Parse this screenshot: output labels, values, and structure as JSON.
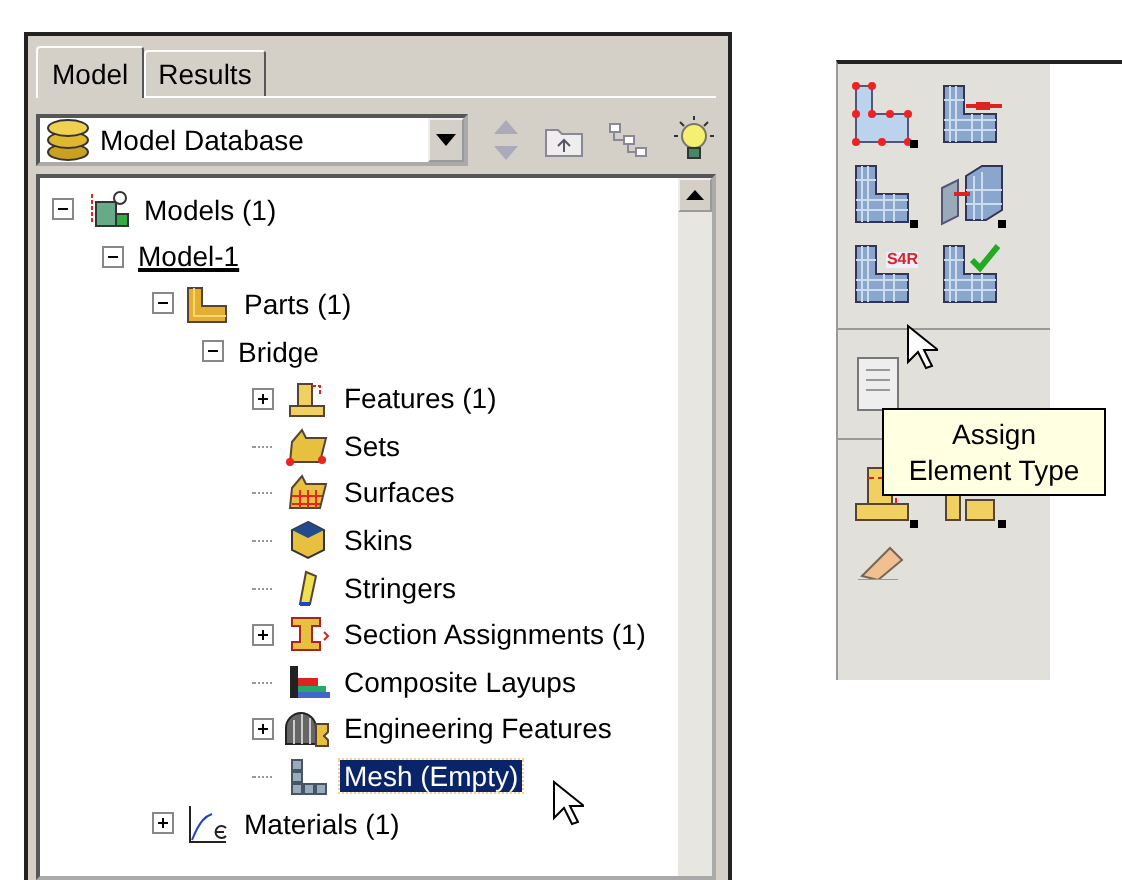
{
  "tabs": [
    {
      "label": "Model",
      "selected": true
    },
    {
      "label": "Results",
      "selected": false
    }
  ],
  "selector": {
    "value": "Model Database"
  },
  "tree": [
    {
      "label": "Models (1)",
      "kind": "models",
      "expanded": true,
      "selected": false,
      "current": false,
      "children": [
        {
          "label": "Model-1",
          "expanded": true,
          "selected": false,
          "current": true,
          "children": [
            {
              "label": "Parts (1)",
              "kind": "parts",
              "expanded": true,
              "selected": false,
              "current": false,
              "children": [
                {
                  "label": "Bridge",
                  "expanded": true,
                  "selected": false,
                  "current": false,
                  "children": [
                    {
                      "label": "Features (1)",
                      "kind": "features",
                      "expanded": false,
                      "selected": false,
                      "current": false
                    },
                    {
                      "label": "Sets",
                      "kind": "sets",
                      "selected": false,
                      "current": false
                    },
                    {
                      "label": "Surfaces",
                      "kind": "surfaces",
                      "selected": false,
                      "current": false
                    },
                    {
                      "label": "Skins",
                      "kind": "skins",
                      "selected": false,
                      "current": false
                    },
                    {
                      "label": "Stringers",
                      "kind": "stringers",
                      "selected": false,
                      "current": false
                    },
                    {
                      "label": "Section Assignments (1)",
                      "kind": "section",
                      "expanded": false,
                      "selected": false,
                      "current": false
                    },
                    {
                      "label": "Composite Layups",
                      "kind": "layups",
                      "selected": false,
                      "current": false
                    },
                    {
                      "label": "Engineering Features",
                      "kind": "engineering",
                      "expanded": false,
                      "selected": false,
                      "current": false
                    },
                    {
                      "label": "Mesh (Empty)",
                      "kind": "mesh",
                      "selected": true,
                      "current": false
                    }
                  ]
                }
              ]
            },
            {
              "label": "Materials (1)",
              "kind": "materials",
              "expanded": false,
              "selected": false,
              "current": false
            }
          ]
        }
      ]
    }
  ],
  "toolbox": {
    "element_type_label": "S4R",
    "tooltip": "Assign\nElement Type"
  }
}
